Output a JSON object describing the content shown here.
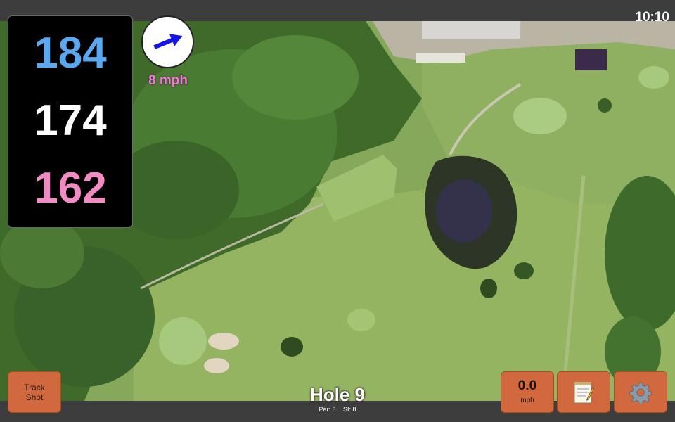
{
  "status": {
    "time": "10:10"
  },
  "yardages": {
    "back": "184",
    "middle": "174",
    "front": "162"
  },
  "wind": {
    "speed_label": "8 mph",
    "arrow_icon": "wind-arrow-icon",
    "arrow_color": "#1414e6"
  },
  "buttons": {
    "track_shot_line1": "Track",
    "track_shot_line2": "Shot",
    "speed_value": "0.0",
    "speed_unit": "mph",
    "notes_icon": "notepad-icon",
    "settings_icon": "gear-icon"
  },
  "hole": {
    "title": "Hole 9",
    "par": "Par: 3",
    "si": "SI: 8"
  },
  "colors": {
    "button": "#d2693e",
    "back_yardage": "#5aa9f0",
    "middle_yardage": "#ffffff",
    "front_yardage": "#f08bc4",
    "wind_label": "#f27cd5"
  }
}
